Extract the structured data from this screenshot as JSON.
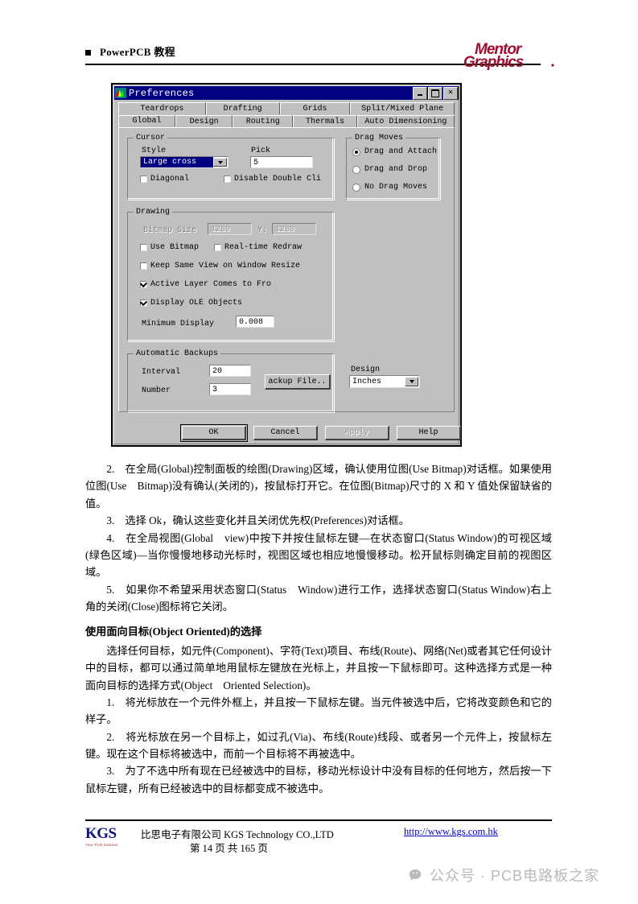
{
  "header": {
    "title": "PowerPCB 教程",
    "logo_top": "Mentor",
    "logo_bottom": "Graphics"
  },
  "dialog": {
    "title": "Preferences",
    "window_buttons": {
      "minimize": "–",
      "maximize": "□",
      "close": "✕"
    },
    "tabs_row1": [
      "Teardrops",
      "Drafting",
      "Grids",
      "Split/Mixed Plane"
    ],
    "tabs_row2": [
      "Global",
      "Design",
      "Routing",
      "Thermals",
      "Auto Dimensioning"
    ],
    "active_tab": "Global",
    "cursor": {
      "group_label": "Cursor",
      "style_label": "Style",
      "style_value": "Large cross",
      "pick_label": "Pick",
      "pick_value": "5",
      "diagonal_label": "Diagonal",
      "diagonal_checked": false,
      "disable_double_click_label": "Disable Double Cli",
      "disable_double_click_checked": false
    },
    "drag_moves": {
      "group_label": "Drag Moves",
      "options": [
        "Drag and Attach",
        "Drag and Drop",
        "No Drag Moves"
      ],
      "selected": "Drag and Attach"
    },
    "drawing": {
      "group_label": "Drawing",
      "bitmap_size_label": "Bitmap Size",
      "bitmap_x": "1280",
      "bitmap_y_label": "Y:",
      "bitmap_y": "1280",
      "use_bitmap_label": "Use Bitmap",
      "use_bitmap_checked": false,
      "realtime_redraw_label": "Real-time Redraw",
      "realtime_redraw_checked": false,
      "keep_same_view_label": "Keep Same View on Window Resize",
      "keep_same_view_checked": false,
      "active_layer_label": "Active Layer Comes to Fro",
      "active_layer_checked": true,
      "display_ole_label": "Display OLE Objects",
      "display_ole_checked": true,
      "minimum_display_label": "Minimum Display",
      "minimum_display_value": "0.008"
    },
    "backups": {
      "group_label": "Automatic Backups",
      "interval_label": "Interval",
      "interval_value": "20",
      "number_label": "Number",
      "number_value": "3",
      "backup_file_button": "ackup File.."
    },
    "design": {
      "label": "Design",
      "units_value": "Inches"
    },
    "buttons": {
      "ok": "OK",
      "cancel": "Cancel",
      "apply": "Apply",
      "apply_disabled": true,
      "help": "Help"
    }
  },
  "body": {
    "p2": "2.　在全局(Global)控制面板的绘图(Drawing)区域，确认使用位图(Use Bitmap)对话框。如果使用位图(Use　Bitmap)没有确认(关闭的)，按鼠标打开它。在位图(Bitmap)尺寸的 X 和 Y 值处保留缺省的值。",
    "p3": "3.　选择 Ok，确认这些变化并且关闭优先权(Preferences)对话框。",
    "p4": "4.　在全局视图(Global　view)中按下并按住鼠标左键—在状态窗口(Status Window)的可视区域(绿色区域)—当你慢慢地移动光标时，视图区域也相应地慢慢移动。松开鼠标则确定目前的视图区域。",
    "p5": "5.　如果你不希望采用状态窗口(Status　Window)进行工作，选择状态窗口(Status Window)右上角的关闭(Close)图标将它关闭。",
    "heading": "使用面向目标(Object Oriented)的选择",
    "p6": "选择任何目标，如元件(Component)、字符(Text)项目、布线(Route)、网络(Net)或者其它任何设计中的目标，都可以通过简单地用鼠标左键放在光标上，并且按一下鼠标即可。这种选择方式是一种面向目标的选择方式(Object　Oriented Selection)。",
    "p7": "1.　将光标放在一个元件外框上，并且按一下鼠标左键。当元件被选中后，它将改变颜色和它的样子。",
    "p8": "2.　将光标放在另一个目标上，如过孔(Via)、布线(Route)线段、或者另一个元件上，按鼠标左键。现在这个目标将被选中，而前一个目标将不再被选中。",
    "p9": "3.　为了不选中所有现在已经被选中的目标，移动光标设计中没有目标的任何地方，然后按一下鼠标左键，所有已经被选中的目标都变成不被选中。"
  },
  "footer": {
    "logo_main": "KGS",
    "logo_sub": "Your PCB Solution",
    "company": "比思电子有限公司 KGS Technology CO.,LTD",
    "page": "第 14 页 共 165 页",
    "url": "http://www.kgs.com.hk"
  },
  "watermark": {
    "text": "公众号 · PCB电路板之家"
  },
  "colors": {
    "titlebar": "#000080",
    "dialog_face": "#c0c0c0",
    "link": "#0000c0",
    "logo_red": "#9b1030"
  }
}
